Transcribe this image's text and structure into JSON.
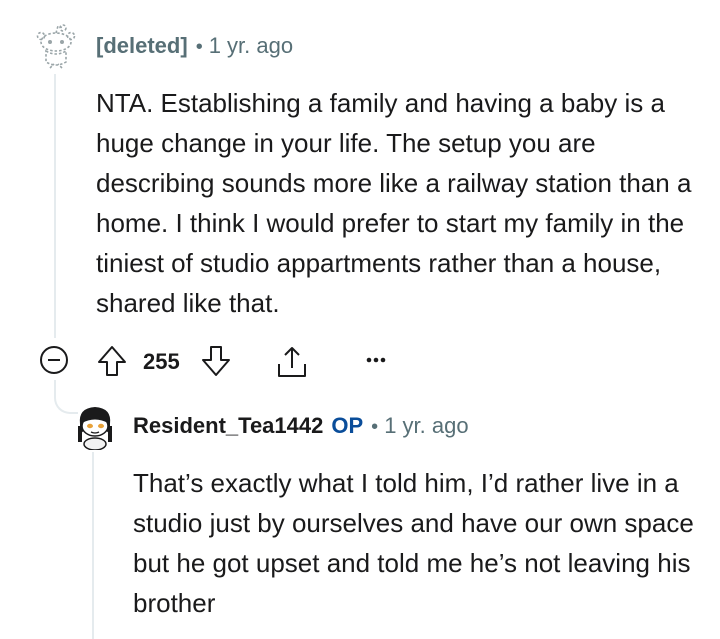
{
  "comment": {
    "author": "[deleted]",
    "separator": "•",
    "time": "1 yr. ago",
    "body": "NTA. Establishing a family and having a baby is a huge change in your life. The setup you are describing sounds more like a railway station than a home. I think I would prefer to start my family in the tiniest of studio appartments rather than a house, shared like that.",
    "actions": {
      "score": "255",
      "collapse_icon": "minus-circle-icon",
      "upvote_icon": "upvote-arrow-icon",
      "downvote_icon": "downvote-arrow-icon",
      "share_icon": "share-icon",
      "more_icon": "more-dots-icon",
      "more_label": "•••"
    }
  },
  "reply": {
    "author": "Resident_Tea1442",
    "badge": "OP",
    "separator": "•",
    "time": "1 yr. ago",
    "body": "That’s exactly what I told him, I’d rather live in a studio just by ourselves and have our own space but he got upset and told me he’s not leaving his brother"
  },
  "colors": {
    "text": "#1a1a1b",
    "meta": "#576f76",
    "op_badge": "#0a4d9a",
    "thread_line": "#e5ebee"
  }
}
